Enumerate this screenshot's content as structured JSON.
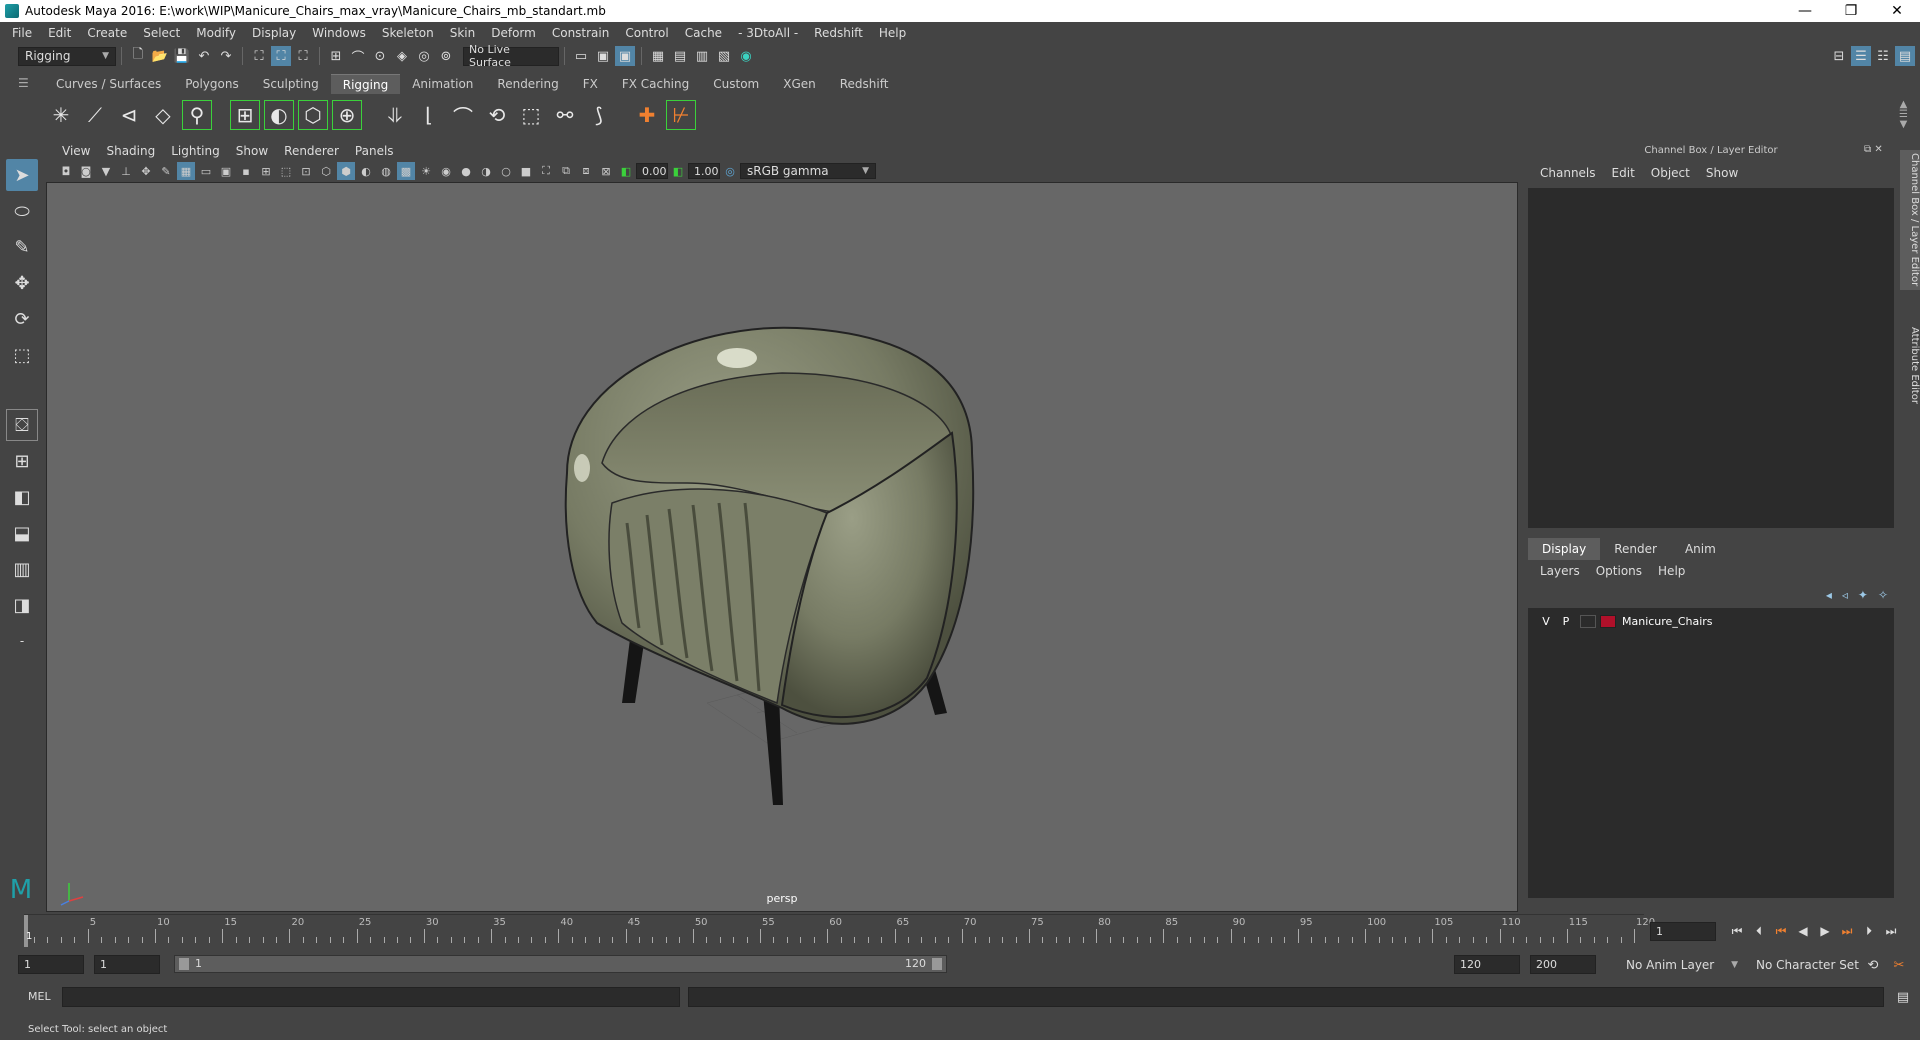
{
  "window": {
    "title": "Autodesk Maya 2016: E:\\work\\WIP\\Manicure_Chairs_max_vray\\Manicure_Chairs_mb_standart.mb",
    "min": "—",
    "restore": "❐",
    "close": "✕"
  },
  "menubar": [
    "File",
    "Edit",
    "Create",
    "Select",
    "Modify",
    "Display",
    "Windows",
    "Skeleton",
    "Skin",
    "Deform",
    "Constrain",
    "Control",
    "Cache",
    "- 3DtoAll -",
    "Redshift",
    "Help"
  ],
  "statusline": {
    "menuset": "Rigging",
    "live_surface": "No Live Surface"
  },
  "shelf": {
    "tabs": [
      "Curves / Surfaces",
      "Polygons",
      "Sculpting",
      "Rigging",
      "Animation",
      "Rendering",
      "FX",
      "FX Caching",
      "Custom",
      "XGen",
      "Redshift"
    ],
    "active_tab": "Rigging"
  },
  "viewport": {
    "panel_menu": [
      "View",
      "Shading",
      "Lighting",
      "Show",
      "Renderer",
      "Panels"
    ],
    "exposure": "0.00",
    "gamma": "1.00",
    "color_space": "sRGB gamma",
    "camera_label": "persp"
  },
  "right_panel": {
    "title": "Channel Box / Layer Editor",
    "channel_menu": [
      "Channels",
      "Edit",
      "Object",
      "Show"
    ],
    "layer_tabs": [
      "Display",
      "Render",
      "Anim"
    ],
    "active_layer_tab": "Display",
    "layer_menu": [
      "Layers",
      "Options",
      "Help"
    ],
    "layers": [
      {
        "v": "V",
        "p": "P",
        "name": "Manicure_Chairs",
        "color": "#b0102a"
      }
    ],
    "side_tabs": [
      "Channel Box / Layer Editor",
      "Attribute Editor"
    ]
  },
  "timeline": {
    "ticks": [
      5,
      10,
      15,
      20,
      25,
      30,
      35,
      40,
      45,
      50,
      55,
      60,
      65,
      70,
      75,
      80,
      85,
      90,
      95,
      100,
      105,
      110,
      115,
      120
    ],
    "start": 1,
    "end": 120,
    "current_frame": "1",
    "current_label": "1"
  },
  "range": {
    "start": "1",
    "playback_start": "1",
    "slider_start": "1",
    "slider_end": "120",
    "playback_end": "120",
    "end": "200",
    "anim_layer": "No Anim Layer",
    "character_set": "No Character Set"
  },
  "cmdline": {
    "label": "MEL"
  },
  "helpline": {
    "text": "Select Tool: select an object"
  }
}
